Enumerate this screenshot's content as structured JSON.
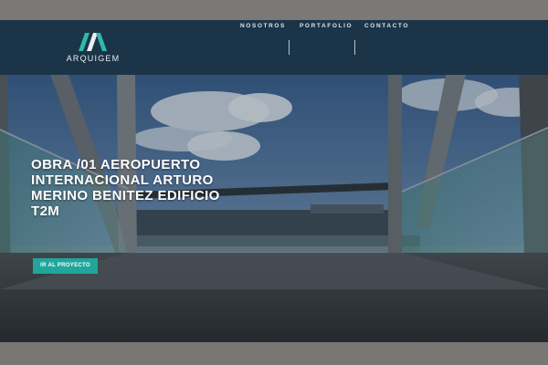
{
  "brand": {
    "name": "ARQUIGEM",
    "accent": "#20a69c",
    "header_bg": "#1b3447"
  },
  "nav": {
    "items": [
      {
        "label": "NOSOTROS"
      },
      {
        "label": "PORTAFOLIO"
      },
      {
        "label": "CONTACTO"
      }
    ]
  },
  "hero": {
    "title": "OBRA /01 AEROPUERTO INTERNACIONAL ARTURO MERINO BENITEZ EDIFICIO T2M",
    "cta_label": "IR AL PROYECTO"
  }
}
